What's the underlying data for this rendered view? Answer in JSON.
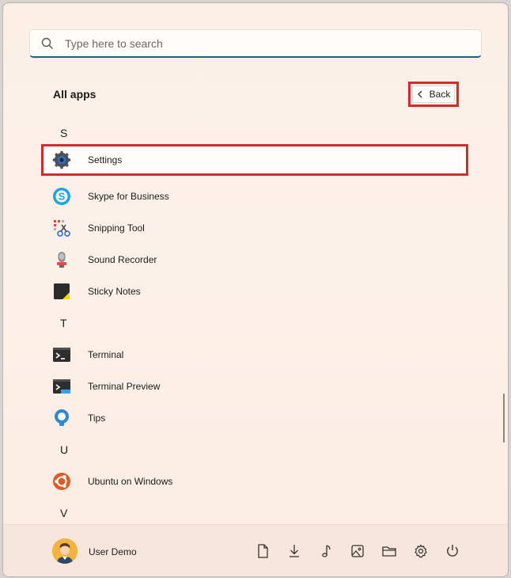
{
  "search": {
    "placeholder": "Type here to search"
  },
  "header": {
    "title": "All apps",
    "back_label": "Back"
  },
  "apps": [
    {
      "letter": "S"
    },
    {
      "label": "Settings",
      "icon": "settings-gear-icon"
    },
    {
      "label": "Skype for Business",
      "icon": "skype-icon"
    },
    {
      "label": "Snipping Tool",
      "icon": "snipping-tool-icon"
    },
    {
      "label": "Sound Recorder",
      "icon": "microphone-icon"
    },
    {
      "label": "Sticky Notes",
      "icon": "sticky-note-icon"
    },
    {
      "letter": "T"
    },
    {
      "label": "Terminal",
      "icon": "terminal-icon"
    },
    {
      "label": "Terminal Preview",
      "icon": "terminal-preview-icon"
    },
    {
      "label": "Tips",
      "icon": "lightbulb-icon"
    },
    {
      "letter": "U"
    },
    {
      "label": "Ubuntu on Windows",
      "icon": "ubuntu-icon"
    },
    {
      "letter": "V"
    }
  ],
  "footer": {
    "user_name": "User Demo",
    "icons": [
      "documents-icon",
      "downloads-icon",
      "music-icon",
      "pictures-icon",
      "file-explorer-icon",
      "settings-icon",
      "power-icon"
    ]
  },
  "colors": {
    "highlight_border": "#d12b2b",
    "accent": "#1f5f86"
  }
}
